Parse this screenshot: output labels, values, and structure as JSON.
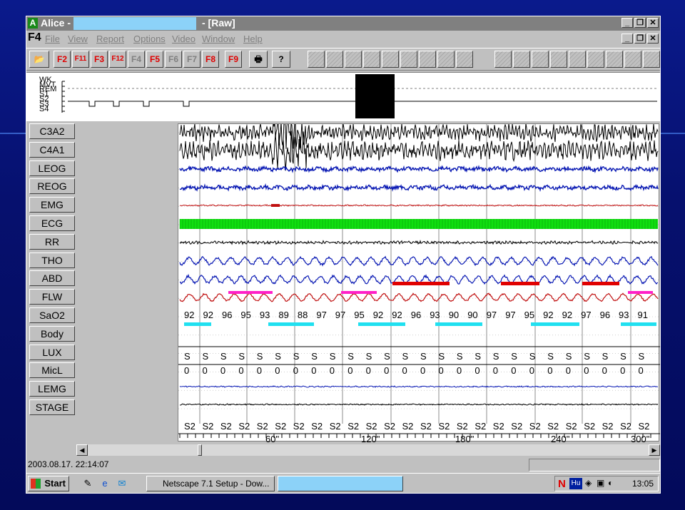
{
  "window": {
    "app": "Alice -",
    "raw": "- [Raw]",
    "min": "_",
    "restore": "❐",
    "close": "✕"
  },
  "menu": {
    "f4": "F4",
    "items": [
      "File",
      "View",
      "Report",
      "Options",
      "Video",
      "Window",
      "Help"
    ]
  },
  "toolbar": {
    "fkeys": [
      "F2",
      "F11",
      "F3",
      "F12",
      "F4",
      "F5",
      "F6",
      "F7",
      "F8",
      "F9"
    ],
    "print_icon": "printer-icon",
    "help_icon": "help-icon",
    "open_icon": "open-folder-icon"
  },
  "hypnogram": {
    "labels": [
      "WK",
      "MVT",
      "REM",
      "S1",
      "S2",
      "S3",
      "S4"
    ]
  },
  "channels": [
    "C3A2",
    "C4A1",
    "LEOG",
    "REOG",
    "EMG",
    "ECG",
    "RR",
    "THO",
    "ABD",
    "FLW",
    "SaO2",
    "Body",
    "LUX",
    "MicL",
    "LEMG",
    "STAGE"
  ],
  "sao2_values": [
    "92",
    "92",
    "96",
    "95",
    "93",
    "89",
    "88",
    "97",
    "97",
    "95",
    "92",
    "92",
    "96",
    "93",
    "90",
    "90",
    "97",
    "97",
    "95",
    "92",
    "92",
    "97",
    "96",
    "93",
    "91"
  ],
  "body_values": [
    "S",
    "S",
    "S",
    "S",
    "S",
    "S",
    "S",
    "S",
    "S",
    "S",
    "S",
    "S",
    "S",
    "S",
    "S",
    "S",
    "S",
    "S",
    "S",
    "S",
    "S",
    "S",
    "S",
    "S",
    "S",
    "S"
  ],
  "lux_values": [
    "0",
    "0",
    "0",
    "0",
    "0",
    "0",
    "0",
    "0",
    "0",
    "0",
    "0",
    "0",
    "0",
    "0",
    "0",
    "0",
    "0",
    "0",
    "0",
    "0",
    "0",
    "0",
    "0",
    "0",
    "0",
    "0"
  ],
  "stage_values": [
    "S2",
    "S2",
    "S2",
    "S2",
    "S2",
    "S2",
    "S2",
    "S2",
    "S2",
    "S2",
    "S2",
    "S2",
    "S2",
    "S2",
    "S2",
    "S2",
    "S2",
    "S2",
    "S2",
    "S2",
    "S2",
    "S2",
    "S2",
    "S2",
    "S2",
    "S2"
  ],
  "time_axis": [
    "60\"",
    "120\"",
    "180\"",
    "240\"",
    "300\""
  ],
  "status": {
    "datetime": "2003.08.17. 22:14:07"
  },
  "taskbar": {
    "start": "Start",
    "task1": "Netscape 7.1 Setup - Dow...",
    "tray_n": "N",
    "tray_hu": "Hu",
    "clock": "13:05"
  },
  "colors": {
    "eeg": "#000000",
    "eog": "#0a1ab4",
    "emg": "#c01010",
    "ecg": "#10e010",
    "flow_event": "#ff20c8",
    "desat_event": "#20e0f0",
    "resp_event": "#e00000"
  }
}
